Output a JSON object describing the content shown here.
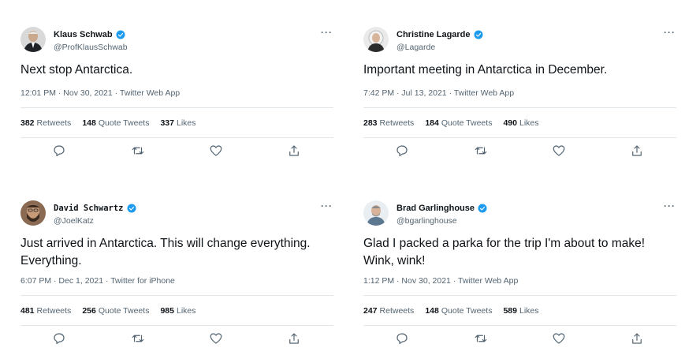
{
  "tweets": [
    {
      "name": "Klaus Schwab",
      "handle": "@ProfKlausSchwab",
      "text": "Next stop Antarctica.",
      "timestamp": "12:01 PM · Nov 30, 2021 · Twitter Web App",
      "retweets": "382",
      "retweets_label": "Retweets",
      "quotes": "148",
      "quotes_label": "Quote Tweets",
      "likes": "337",
      "likes_label": "Likes",
      "more": "···"
    },
    {
      "name": "Christine Lagarde",
      "handle": "@Lagarde",
      "text": "Important meeting in Antarctica in December.",
      "timestamp": "7:42 PM · Jul 13, 2021 · Twitter Web App",
      "retweets": "283",
      "retweets_label": "Retweets",
      "quotes": "184",
      "quotes_label": "Quote Tweets",
      "likes": "490",
      "likes_label": "Likes",
      "more": "···"
    },
    {
      "name": "David Schwartz",
      "handle": "@JoelKatz",
      "text": "Just arrived in Antarctica. This will change everything. Everything.",
      "timestamp": "6:07 PM · Dec 1, 2021 · Twitter for iPhone",
      "retweets": "481",
      "retweets_label": "Retweets",
      "quotes": "256",
      "quotes_label": "Quote Tweets",
      "likes": "985",
      "likes_label": "Likes",
      "more": "···"
    },
    {
      "name": "Brad Garlinghouse",
      "handle": "@bgarlinghouse",
      "text": "Glad I packed a parka for the trip I'm about to make! Wink, wink!",
      "timestamp": "1:12 PM · Nov 30, 2021 · Twitter Web App",
      "retweets": "247",
      "retweets_label": "Retweets",
      "quotes": "148",
      "quotes_label": "Quote Tweets",
      "likes": "589",
      "likes_label": "Likes",
      "more": "···"
    }
  ],
  "icons": {
    "verified": "verified-badge-icon",
    "reply": "reply-icon",
    "retweet": "retweet-icon",
    "like": "heart-icon",
    "share": "share-icon",
    "more": "more-options-icon"
  },
  "colors": {
    "text": "#0f1419",
    "secondary": "#536471",
    "verified": "#1d9bf0",
    "divider": "#e1e6ea"
  }
}
